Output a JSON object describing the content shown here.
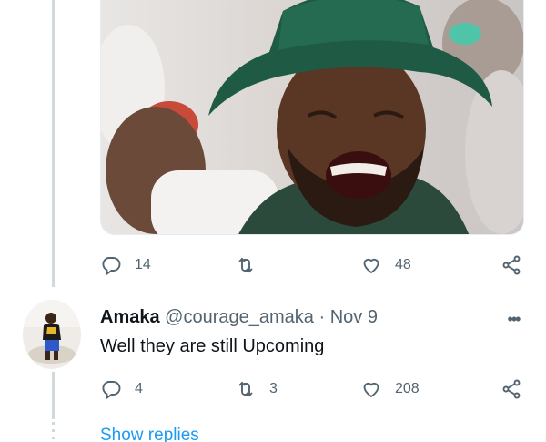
{
  "tweet1": {
    "media_alt": "photo-crying-man-bucket-hat",
    "actions": {
      "reply_count": "14",
      "retweet_count": "",
      "like_count": "48"
    }
  },
  "tweet2": {
    "author_name": "Amaka",
    "handle": "@courage_amaka",
    "separator": "·",
    "date": "Nov 9",
    "text": "Well they are still Upcoming",
    "more_label": "•••",
    "actions": {
      "reply_count": "4",
      "retweet_count": "3",
      "like_count": "208"
    }
  },
  "show_replies": "Show replies",
  "colors": {
    "accent": "#1d9bf0",
    "muted": "#536471",
    "text": "#0f1419",
    "line": "#cfd9de"
  },
  "icons": [
    "reply-icon",
    "retweet-icon",
    "like-icon",
    "share-icon",
    "more-icon"
  ]
}
